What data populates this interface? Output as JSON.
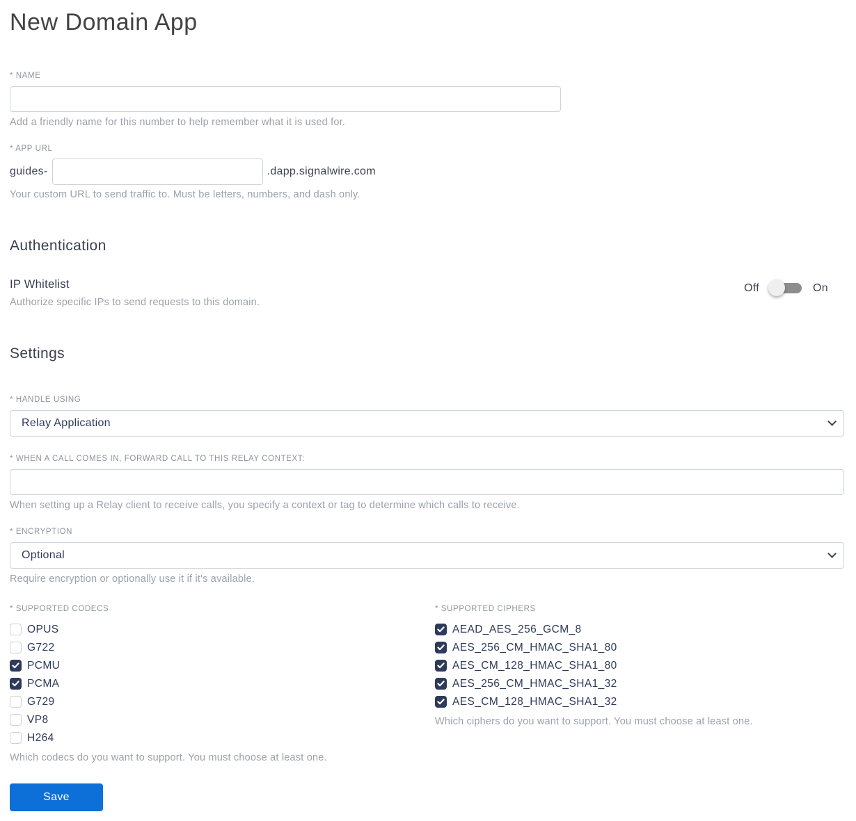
{
  "page": {
    "title": "New Domain App"
  },
  "colors": {
    "accent_blue": "#0d6fd8",
    "checkbox_navy": "#2e3a59",
    "label_grey": "#8d939e",
    "helper_grey": "#9aa1ab",
    "border_grey": "#ced4da",
    "toggle_track": "#8d8d8d"
  },
  "name_field": {
    "label": "* NAME",
    "value": "",
    "helper": "Add a friendly name for this number to help remember what it is used for."
  },
  "app_url": {
    "label": "* APP URL",
    "prefix": "guides-",
    "value": "",
    "suffix": ".dapp.signalwire.com",
    "helper": "Your custom URL to send traffic to. Must be letters, numbers, and dash only."
  },
  "authentication": {
    "heading": "Authentication",
    "ip_whitelist": {
      "label": "IP Whitelist",
      "helper": "Authorize specific IPs to send requests to this domain.",
      "off_label": "Off",
      "on_label": "On",
      "state": "off"
    }
  },
  "settings": {
    "heading": "Settings",
    "handle_using": {
      "label": "* HANDLE USING",
      "selected": "Relay Application"
    },
    "relay_context": {
      "label": "* WHEN A CALL COMES IN, FORWARD CALL TO THIS RELAY CONTEXT:",
      "value": "",
      "helper": "When setting up a Relay client to receive calls, you specify a context or tag to determine which calls to receive."
    },
    "encryption": {
      "label": "* ENCRYPTION",
      "selected": "Optional",
      "helper": "Require encryption or optionally use it if it's available."
    },
    "codecs": {
      "label": "* SUPPORTED CODECS",
      "items": [
        {
          "label": "OPUS",
          "checked": false
        },
        {
          "label": "G722",
          "checked": false
        },
        {
          "label": "PCMU",
          "checked": true
        },
        {
          "label": "PCMA",
          "checked": true
        },
        {
          "label": "G729",
          "checked": false
        },
        {
          "label": "VP8",
          "checked": false
        },
        {
          "label": "H264",
          "checked": false
        }
      ],
      "helper": "Which codecs do you want to support. You must choose at least one."
    },
    "ciphers": {
      "label": "* SUPPORTED CIPHERS",
      "items": [
        {
          "label": "AEAD_AES_256_GCM_8",
          "checked": true
        },
        {
          "label": "AES_256_CM_HMAC_SHA1_80",
          "checked": true
        },
        {
          "label": "AES_CM_128_HMAC_SHA1_80",
          "checked": true
        },
        {
          "label": "AES_256_CM_HMAC_SHA1_32",
          "checked": true
        },
        {
          "label": "AES_CM_128_HMAC_SHA1_32",
          "checked": true
        }
      ],
      "helper": "Which ciphers do you want to support. You must choose at least one."
    }
  },
  "save_button": {
    "label": "Save"
  }
}
